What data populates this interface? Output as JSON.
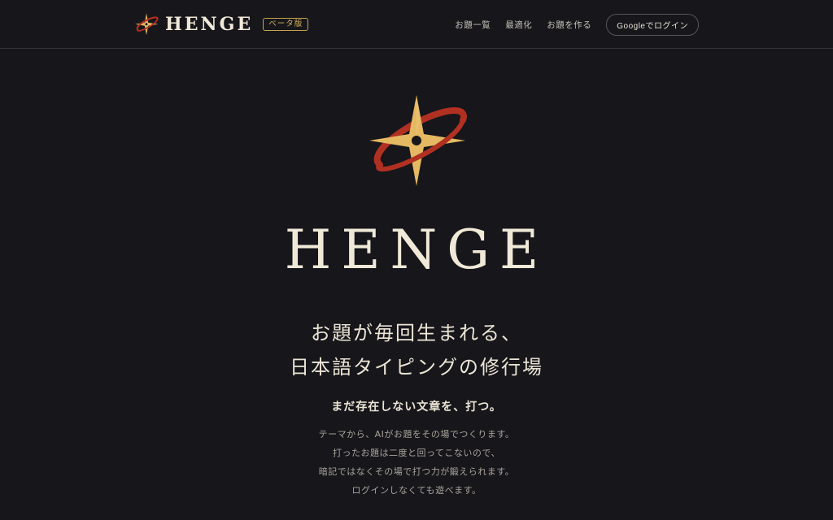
{
  "header": {
    "brand_name": "HENGE",
    "beta_label": "ベータ版",
    "nav": [
      {
        "label": "お題一覧"
      },
      {
        "label": "最適化"
      },
      {
        "label": "お題を作る"
      }
    ],
    "login_label": "Googleでログイン"
  },
  "hero": {
    "title": "HENGE",
    "tagline_line1": "お題が毎回生まれる、",
    "tagline_line2": "日本語タイピングの修行場",
    "subtagline": "まだ存在しない文章を、打つ。",
    "description": [
      "テーマから、AIがお題をその場でつくります。",
      "打ったお題は二度と回ってこないので、",
      "暗記ではなくその場で打つ力が鍛えられます。",
      "ログインしなくても遊べます。"
    ]
  },
  "icons": {
    "logo": "shuriken-orbit-icon"
  },
  "colors": {
    "background": "#16161b",
    "star_gold": "#e5b862",
    "orbit_red": "#b03022",
    "text_cream": "#f1e9d8",
    "badge_gold": "#d8b45a"
  }
}
